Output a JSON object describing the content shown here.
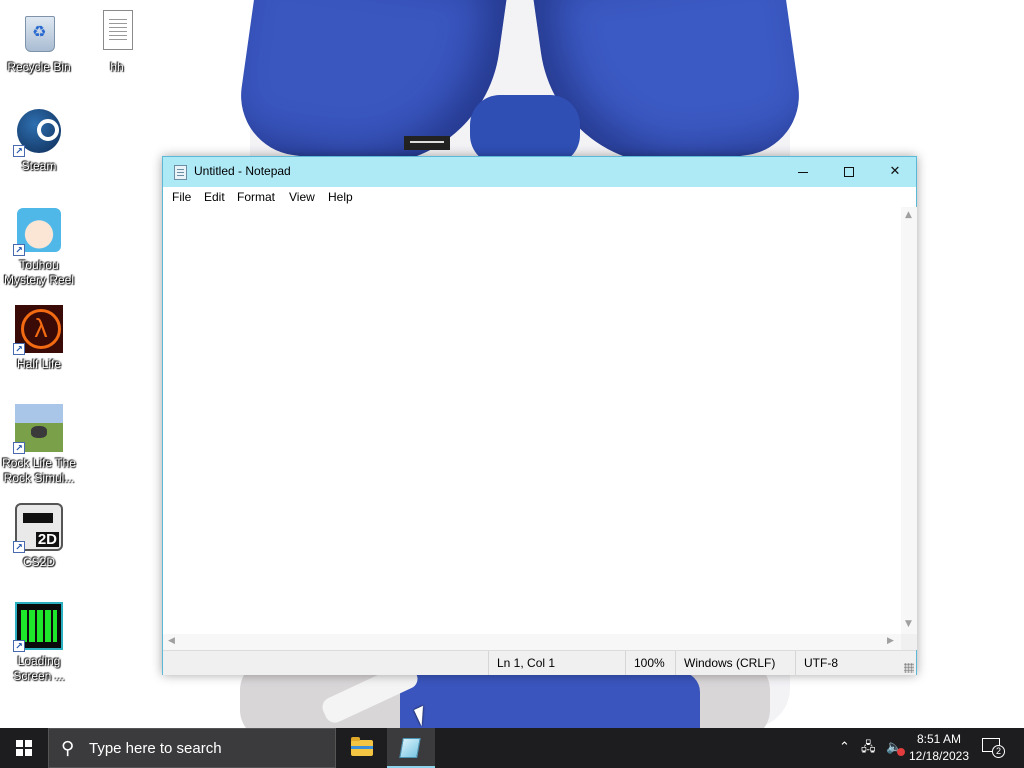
{
  "desktop": {
    "icons": [
      {
        "label": "Recycle Bin",
        "icon": "recycle-bin-icon",
        "shortcut": false
      },
      {
        "label": "hh",
        "icon": "text-file-icon",
        "shortcut": false
      },
      {
        "label": "Steam",
        "icon": "steam-icon",
        "shortcut": true
      },
      {
        "label": "Touhou Mystery Reel",
        "icon": "touhou-icon",
        "shortcut": true
      },
      {
        "label": "Half Life",
        "icon": "half-life-icon",
        "shortcut": true
      },
      {
        "label": "Rock Life The Rock Simul...",
        "icon": "rock-life-icon",
        "shortcut": true
      },
      {
        "label": "CS2D",
        "icon": "cs2d-icon",
        "shortcut": true
      },
      {
        "label": "Loading Screen ...",
        "icon": "loading-screen-icon",
        "shortcut": true
      }
    ]
  },
  "notepad": {
    "title": "Untitled - Notepad",
    "menu": [
      "File",
      "Edit",
      "Format",
      "View",
      "Help"
    ],
    "content": "",
    "status": {
      "position": "Ln 1, Col 1",
      "zoom": "100%",
      "line_ending": "Windows (CRLF)",
      "encoding": "UTF-8"
    },
    "title_bar_color": "#aee9f6"
  },
  "taskbar": {
    "search_placeholder": "Type here to search",
    "pinned": [
      {
        "name": "File Explorer",
        "icon": "folder-icon",
        "active": false
      },
      {
        "name": "Notepad",
        "icon": "notepad-icon",
        "active": true
      }
    ],
    "clock": {
      "time": "8:51 AM",
      "date": "12/18/2023"
    },
    "notification_count": "2"
  }
}
